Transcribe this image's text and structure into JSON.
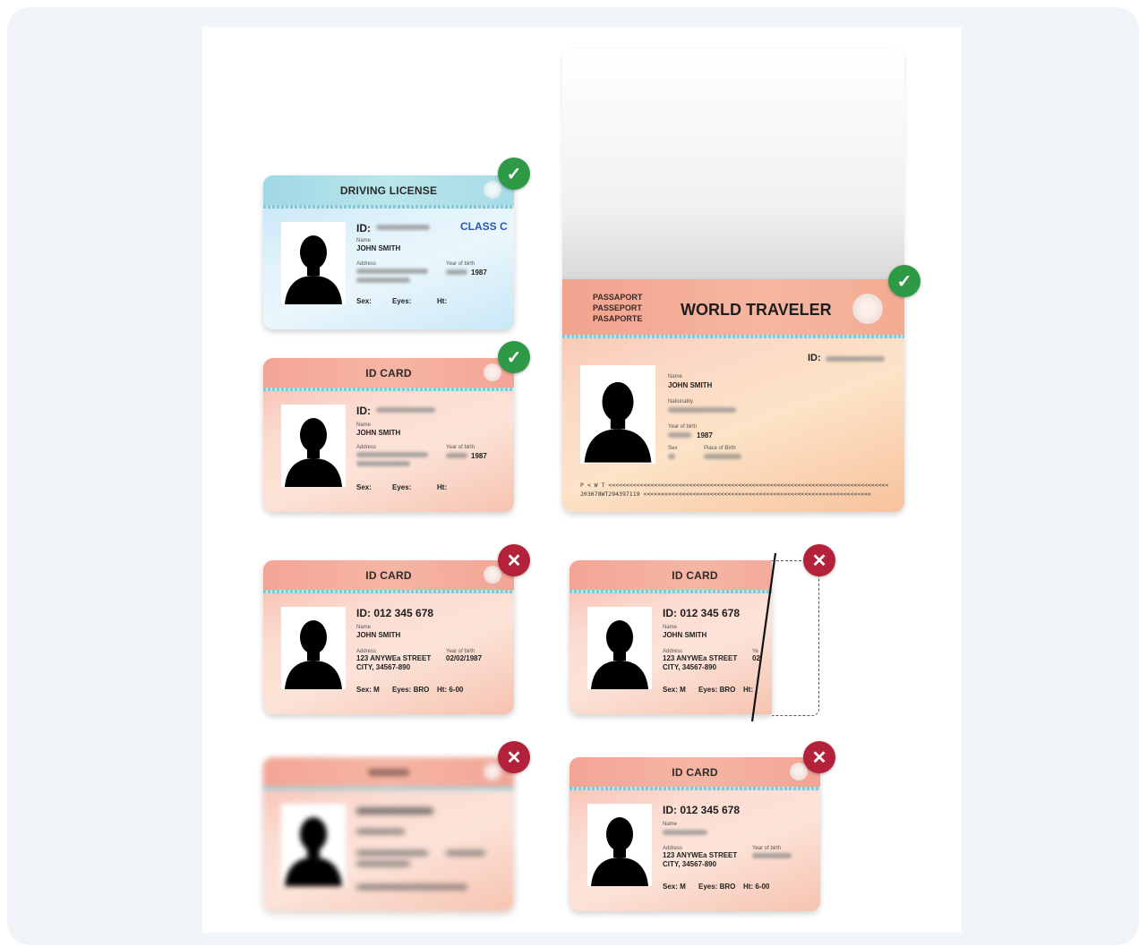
{
  "driving_license": {
    "title": "DRIVING LICENSE",
    "id_label": "ID:",
    "class_label": "CLASS C",
    "name_label": "Name",
    "name": "JOHN SMITH",
    "address_label": "Address",
    "yob_label": "Year of birth",
    "yob": "1987",
    "sex_label": "Sex:",
    "eyes_label": "Eyes:",
    "ht_label": "Ht:"
  },
  "id_card_valid": {
    "title": "ID CARD",
    "id_label": "ID:",
    "name_label": "Name",
    "name": "JOHN SMITH",
    "address_label": "Address",
    "yob_label": "Year of birth",
    "yob": "1987",
    "sex_label": "Sex:",
    "eyes_label": "Eyes:",
    "ht_label": "Ht:"
  },
  "passport": {
    "words": [
      "PASSAPORT",
      "PASSEPORT",
      "PASAPORTE"
    ],
    "title": "WORLD TRAVELER",
    "id_label": "ID:",
    "name_label": "Name",
    "name": "JOHN SMITH",
    "nationality_label": "Nationality",
    "yob_label": "Year of birth",
    "yob": "1987",
    "sex_label": "Sex",
    "pob_label": "Place of Birth",
    "mrz1": "P < W T <<<<<<<<<<<<<<<<<<<<<<<<<<<<<<<<<<<<<<<<<<<<<<<<<<<<<<<<<<<<<<<<<<<<<<<<<<<<<<<<",
    "mrz2": "203678WT294397119 <<<<<<<<<<<<<<<<<<<<<<<<<<<<<<<<<<<<<<<<<<<<<<<<<<<<<<<<<<<<<<<<<"
  },
  "id_card_glare": {
    "title": "ID CARD",
    "id": "ID: 012 345 678",
    "name_label": "Name",
    "name": "JOHN SMITH",
    "address_label": "Address",
    "address1": "123 ANYWEa STREET",
    "address2": "CITY, 34567-890",
    "yob_label": "Year of birth",
    "yob": "02/02/1987",
    "sex": "Sex: M",
    "eyes": "Eyes: BRO",
    "ht": "Ht: 6-00"
  },
  "id_card_cropped": {
    "title": "ID CARD",
    "id": "ID: 012 345 678",
    "name_label": "Name",
    "name": "JOHN SMITH",
    "address_label": "Address",
    "address1": "123 ANYWEa STREET",
    "address2": "CITY, 34567-890",
    "yob_label_partial": "Ye",
    "yob_partial": "02",
    "sex": "Sex: M",
    "eyes": "Eyes: BRO",
    "ht": "Ht:"
  },
  "id_card_missing": {
    "title": "ID CARD",
    "id": "ID: 012 345 678",
    "name_label": "Name",
    "address_label": "Address",
    "address1": "123 ANYWEa STREET",
    "address2": "CITY, 34567-890",
    "yob_label": "Year of birth",
    "sex": "Sex: M",
    "eyes": "Eyes: BRO",
    "ht": "Ht: 6-00"
  },
  "badges": {
    "ok": "✓",
    "bad": "✕",
    "ok_color": "#2f9a46",
    "bad_color": "#b3223a"
  }
}
